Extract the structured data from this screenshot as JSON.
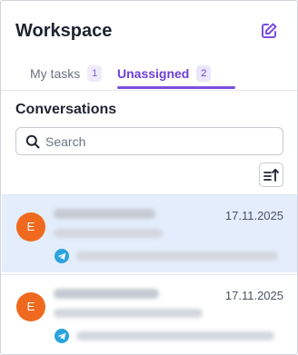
{
  "header": {
    "title": "Workspace",
    "compose_icon": "edit-square-icon"
  },
  "tabs": [
    {
      "label": "My tasks",
      "count": "1",
      "active": false
    },
    {
      "label": "Unassigned",
      "count": "2",
      "active": true
    }
  ],
  "section": {
    "title": "Conversations"
  },
  "search": {
    "placeholder": "Search",
    "value": "",
    "icon": "search-icon"
  },
  "sort": {
    "icon": "sort-ascending-icon"
  },
  "conversations": [
    {
      "avatar_letter": "E",
      "date": "17.11.2025",
      "channel_icon": "telegram-icon",
      "selected": true
    },
    {
      "avatar_letter": "E",
      "date": "17.11.2025",
      "channel_icon": "telegram-icon",
      "selected": false
    }
  ],
  "colors": {
    "accent": "#7b4fe0",
    "avatar": "#ef6a1f",
    "selected_row": "#e4edfb",
    "telegram": "#2aa3df"
  }
}
